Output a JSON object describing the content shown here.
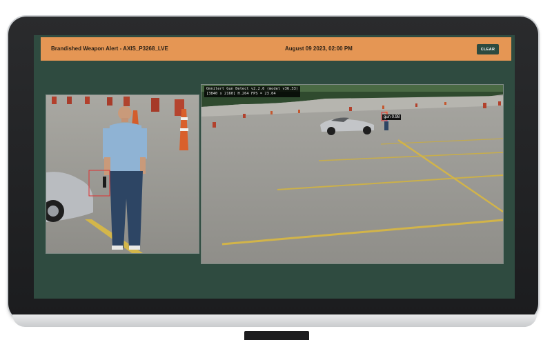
{
  "alert": {
    "title": "Brandished Weapon Alert - AXIS_P3268_LVE",
    "datetime": "August 09 2023, 02:00 PM",
    "clear_label": "CLEAR"
  },
  "detector_overlay": {
    "line1": "Omnilert Gun Detect v2.2.6 (model v36.33)",
    "line2": "[3840 x 2160] H.264 FPS = 23.04"
  },
  "detection": {
    "label": "gun 0.98"
  },
  "colors": {
    "alert_bar": "#e59654",
    "screen_bg": "#2f4b40",
    "detection_box": "#e03030"
  },
  "icons": {
    "monitor": "monitor-frame"
  }
}
